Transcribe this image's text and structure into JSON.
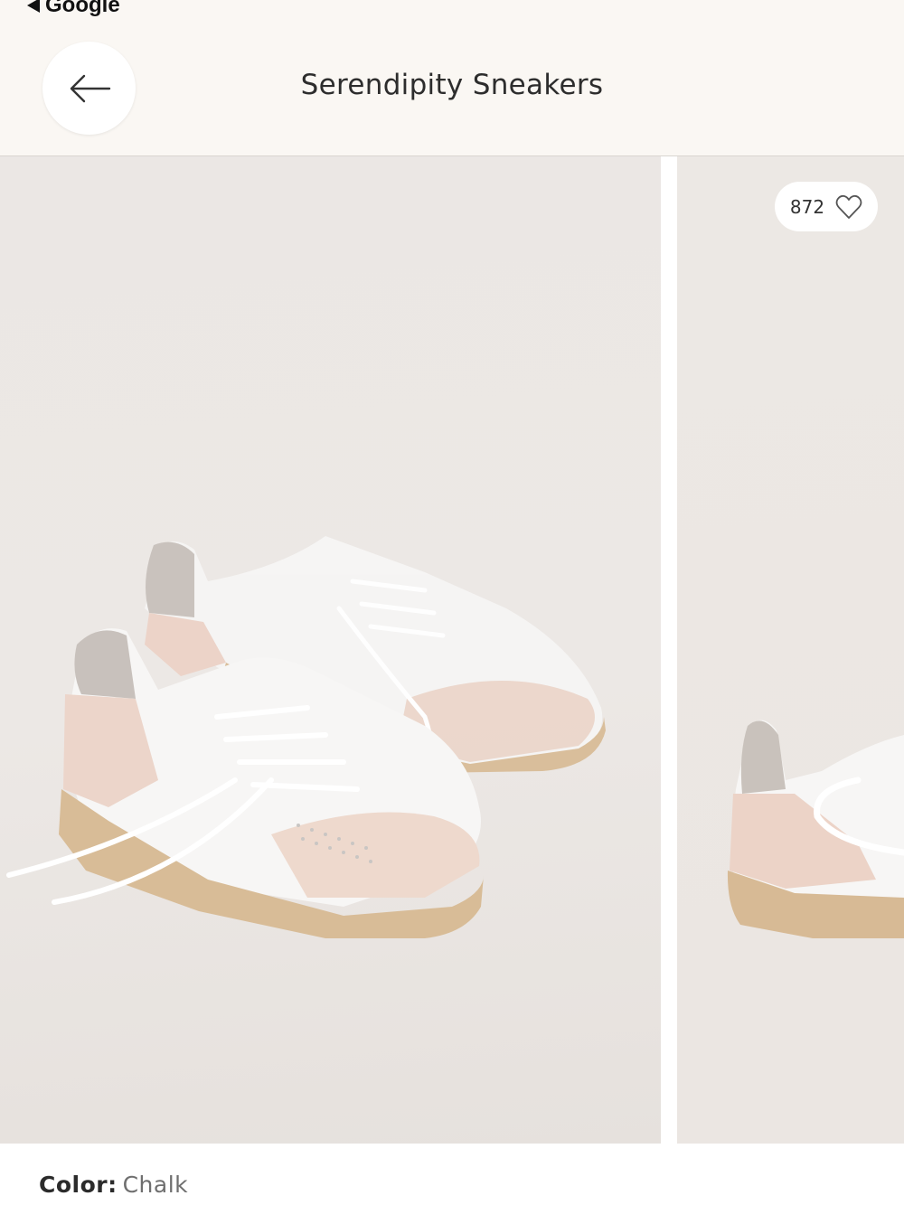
{
  "status_bar": {
    "back_app_label": "Google"
  },
  "header": {
    "title": "Serendipity Sneakers",
    "back_icon": "arrow-left-icon"
  },
  "gallery": {
    "likes_count": "872",
    "like_icon": "heart-outline-icon"
  },
  "product": {
    "color_label": "Color:",
    "color_value": "Chalk"
  },
  "colors": {
    "header_bg": "#faf7f3",
    "photo_bg": "#ebe7e4",
    "title_text": "#2d2d2d"
  }
}
